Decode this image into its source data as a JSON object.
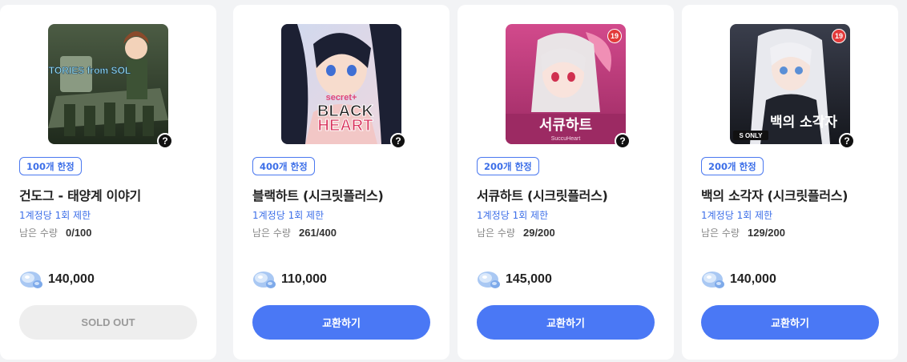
{
  "products": [
    {
      "limit_badge": "400개 한정",
      "title": "블랙하트 (시크릿플러스)",
      "per_limit": "1계정당 1회 제한",
      "stock_label": "남은 수량",
      "stock_value": "261/400",
      "price": "110,000",
      "button_label": "교환하기",
      "sold_out": false,
      "age_badge": "",
      "thumb_text": "BLACK HEART",
      "thumb_subtext": "secret+",
      "accent": "#c93a5a"
    },
    {
      "limit_badge": "200개 한정",
      "title": "서큐하트 (시크릿플러스)",
      "per_limit": "1계정당 1회 제한",
      "stock_label": "남은 수량",
      "stock_value": "29/200",
      "price": "145,000",
      "button_label": "교환하기",
      "sold_out": false,
      "age_badge": "19",
      "thumb_text": "서큐하트",
      "thumb_subtext": "SuccuHeart",
      "accent": "#b0306e"
    },
    {
      "limit_badge": "200개 한정",
      "title": "백의 소각자 (시크릿플러스)",
      "per_limit": "1계정당 1회 제한",
      "stock_label": "남은 수량",
      "stock_value": "129/200",
      "price": "140,000",
      "button_label": "교환하기",
      "sold_out": false,
      "age_badge": "19",
      "thumb_text": "백의 소각자",
      "thumb_subtext": "S ONLY",
      "accent": "#2a2d38"
    },
    {
      "limit_badge": "100개 한정",
      "title": "건도그 - 태양계 이야기",
      "per_limit": "1계정당 1회 제한",
      "stock_label": "남은 수량",
      "stock_value": "0/100",
      "price": "140,000",
      "button_label": "SOLD OUT",
      "sold_out": true,
      "age_badge": "",
      "thumb_text": "STORIES from SOL",
      "thumb_subtext": "",
      "accent": "#3e4a34"
    }
  ],
  "icons": {
    "help": "question-icon",
    "currency": "gem-currency-icon"
  },
  "colors": {
    "primary": "#4a78f5",
    "link": "#3d6fe8",
    "background": "#f2f3f5"
  }
}
